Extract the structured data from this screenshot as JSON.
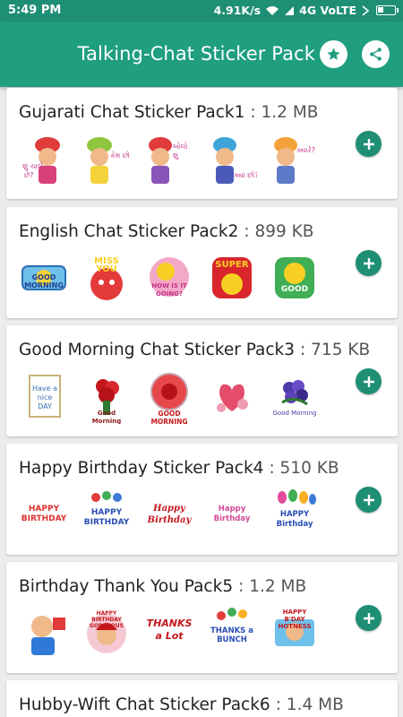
{
  "status_bar": {
    "time": "5:49 PM",
    "speed": "4.91K/s",
    "network": "4G VoLTE"
  },
  "app_bar": {
    "title": "Talking-Chat Sticker Pack",
    "star_icon": "star-icon",
    "share_icon": "share-icon"
  },
  "colors": {
    "primary": "#1f9e80",
    "primary_dark": "#1e8e74"
  },
  "packs": [
    {
      "name": "Gujarati Chat Sticker Pack1",
      "size": ": 1.2 MB"
    },
    {
      "name": "English Chat Sticker Pack2",
      "size": ": 899 KB"
    },
    {
      "name": "Good Morning Chat Sticker Pack3",
      "size": ": 715 KB"
    },
    {
      "name": "Happy Birthday Sticker Pack4",
      "size": ": 510 KB"
    },
    {
      "name": "Birthday Thank You Pack5",
      "size": ": 1.2 MB"
    },
    {
      "name": "Hubby-Wift Chat Sticker Pack6",
      "size": ": 1.4 MB"
    }
  ],
  "sticker_captions": {
    "pack2": [
      "GOOD MORNING",
      "MISS YOU",
      "HOW IS IT GOING?",
      "SUPER",
      "GOOD"
    ],
    "pack3": [
      "Have a nice DAY",
      "Good Morning",
      "GOOD MORNING",
      "",
      "Good Morning"
    ],
    "pack4": [
      "HAPPY BIRTHDAY",
      "HAPPY BIRTHDAY",
      "Happy Birthday",
      "Happy Birthday",
      "HAPPY Birthday"
    ],
    "pack5": [
      "HAPPY BIRTHDAY GORGEOUS",
      "",
      "THANKS a Lot",
      "THANKS a BUNCH",
      "HAPPY B'DAY HOTNESS"
    ]
  },
  "add_icon": "plus-icon"
}
